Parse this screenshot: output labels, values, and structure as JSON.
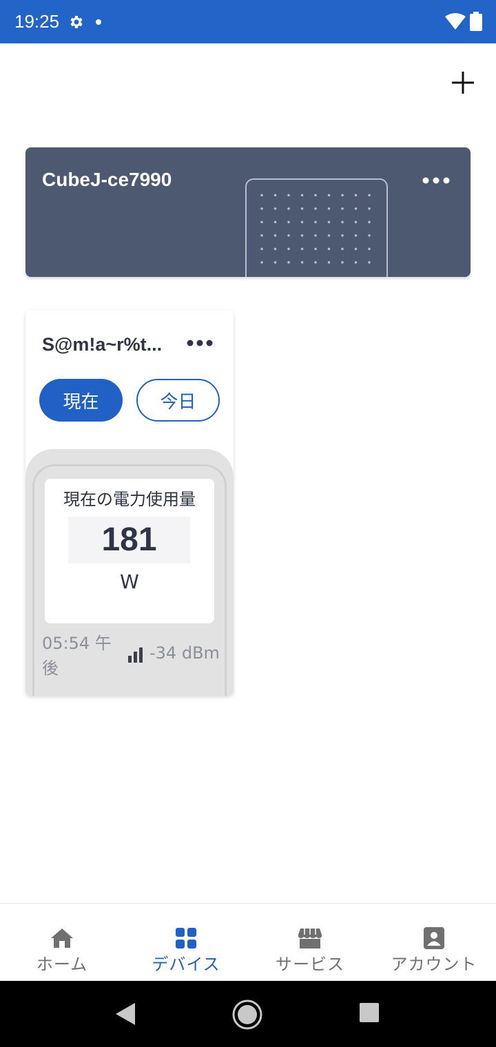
{
  "status_bar": {
    "time": "19:25"
  },
  "hub_card": {
    "name": "CubeJ-ce7990"
  },
  "plug_card": {
    "name": "S@m!a~r%t...",
    "tabs": [
      {
        "label": "現在",
        "active": true
      },
      {
        "label": "今日",
        "active": false
      }
    ],
    "reading_label": "現在の電力使用量",
    "reading_value": "181",
    "reading_unit": "W",
    "timestamp": "05:54 午後",
    "signal": "-34 dBm"
  },
  "bottom_nav": {
    "items": [
      {
        "label": "ホーム",
        "icon": "home-icon",
        "active": false
      },
      {
        "label": "デバイス",
        "icon": "devices-icon",
        "active": true
      },
      {
        "label": "サービス",
        "icon": "store-icon",
        "active": false
      },
      {
        "label": "アカウント",
        "icon": "account-icon",
        "active": false
      }
    ]
  },
  "colors": {
    "status_bar": "#2264c8",
    "accent": "#2160c4",
    "hub_card": "#4d5970",
    "text": "#2f3447",
    "muted": "#8a8f99"
  }
}
